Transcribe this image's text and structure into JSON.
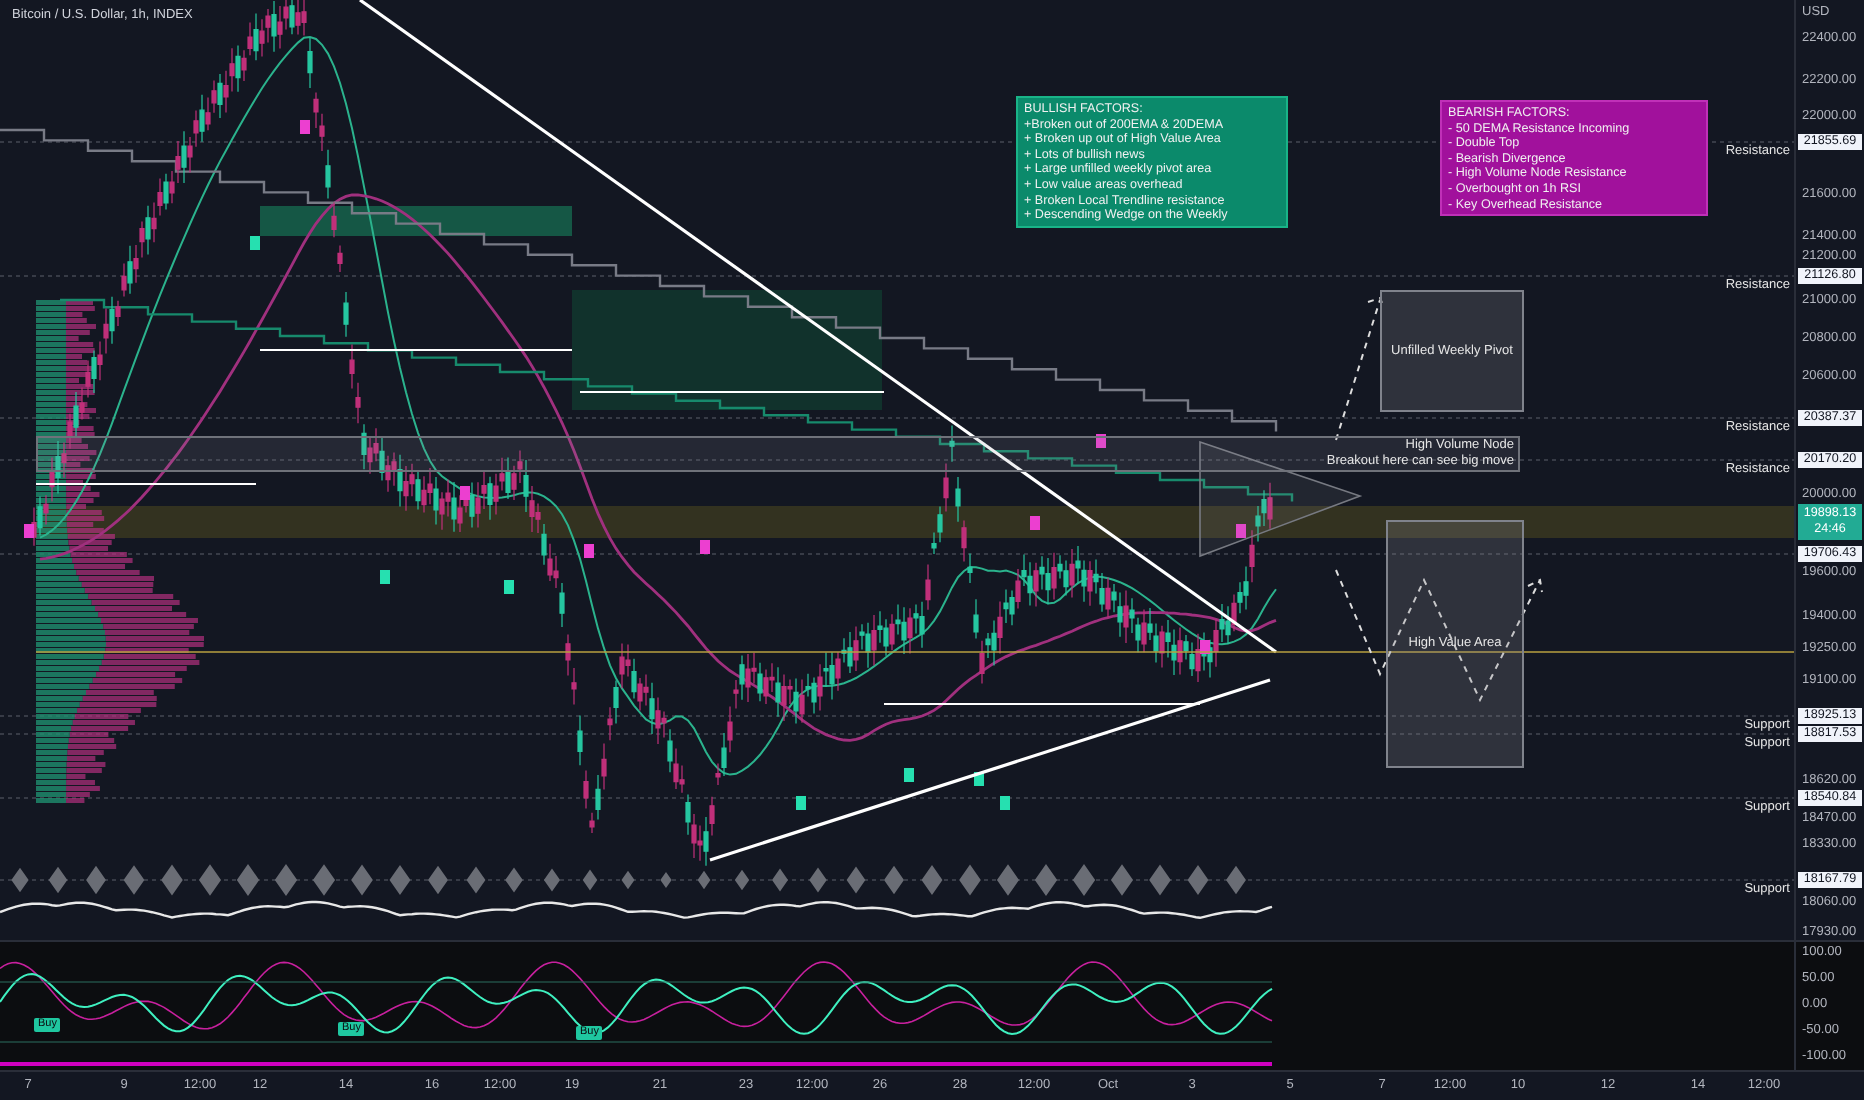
{
  "chart": {
    "title": "Bitcoin / U.S. Dollar, 1h, INDEX"
  },
  "notes": [
    {
      "kind": "bullish",
      "title": "BULLISH FACTORS:",
      "lines": [
        "+Broken out of 200EMA & 20DEMA",
        "+ Broken up out of High Value Area",
        "+ Lots of bullish news",
        "+ Large unfilled weekly pivot area",
        "+ Low value areas overhead",
        "+ Broken Local Trendline resistance",
        "+ Descending Wedge on the Weekly"
      ]
    },
    {
      "kind": "bearish",
      "title": "BEARISH FACTORS:",
      "lines": [
        "- 50 DEMA Resistance Incoming",
        "- Double Top",
        "- Bearish Divergence",
        "- High Volume Node Resistance",
        "- Overbought on 1h RSI",
        "- Key Overhead Resistance"
      ]
    }
  ],
  "zones": [
    {
      "kind": "weekly_pivot",
      "lines": [
        "Unfilled Weekly Pivot"
      ]
    },
    {
      "kind": "volume_node",
      "lines": [
        "High Volume Node",
        "Breakout here can see big move"
      ]
    },
    {
      "kind": "value_area",
      "lines": [
        "High Value Area"
      ]
    }
  ],
  "levels": [
    {
      "label": "Resistance",
      "price": "21855.69"
    },
    {
      "label": "Resistance",
      "price": "21126.80"
    },
    {
      "label": "Resistance",
      "price": "20387.37"
    },
    {
      "label": "Resistance",
      "price": "20170.20"
    },
    {
      "price": "19706.43"
    },
    {
      "label": "Support",
      "price": "18925.13"
    },
    {
      "label": "Support",
      "price": "18817.53"
    },
    {
      "label": "Support",
      "price": "18540.84"
    },
    {
      "label": "Support",
      "price": "18167.79"
    }
  ],
  "current_price": {
    "price": "19898.13",
    "countdown": "24:46"
  },
  "price_axis": {
    "unit": "USD",
    "ticks": [
      "22400.00",
      "22200.00",
      "22000.00",
      "21600.00",
      "21400.00",
      "21200.00",
      "21000.00",
      "20800.00",
      "20600.00",
      "20000.00",
      "19600.00",
      "19400.00",
      "19250.00",
      "19100.00",
      "18620.00",
      "18470.00",
      "18330.00",
      "18060.00",
      "17930.00"
    ]
  },
  "oscillator": {
    "ticks": [
      "100.00",
      "50.00",
      "0.00",
      "-50.00",
      "-100.00"
    ],
    "signals": [
      "Buy",
      "Buy",
      "Buy"
    ]
  },
  "time_axis": [
    "7",
    "9",
    "12:00",
    "12",
    "14",
    "16",
    "12:00",
    "19",
    "21",
    "23",
    "12:00",
    "26",
    "28",
    "12:00",
    "Oct",
    "3",
    "5",
    "7",
    "12:00",
    "10",
    "12",
    "14",
    "12:00"
  ]
}
